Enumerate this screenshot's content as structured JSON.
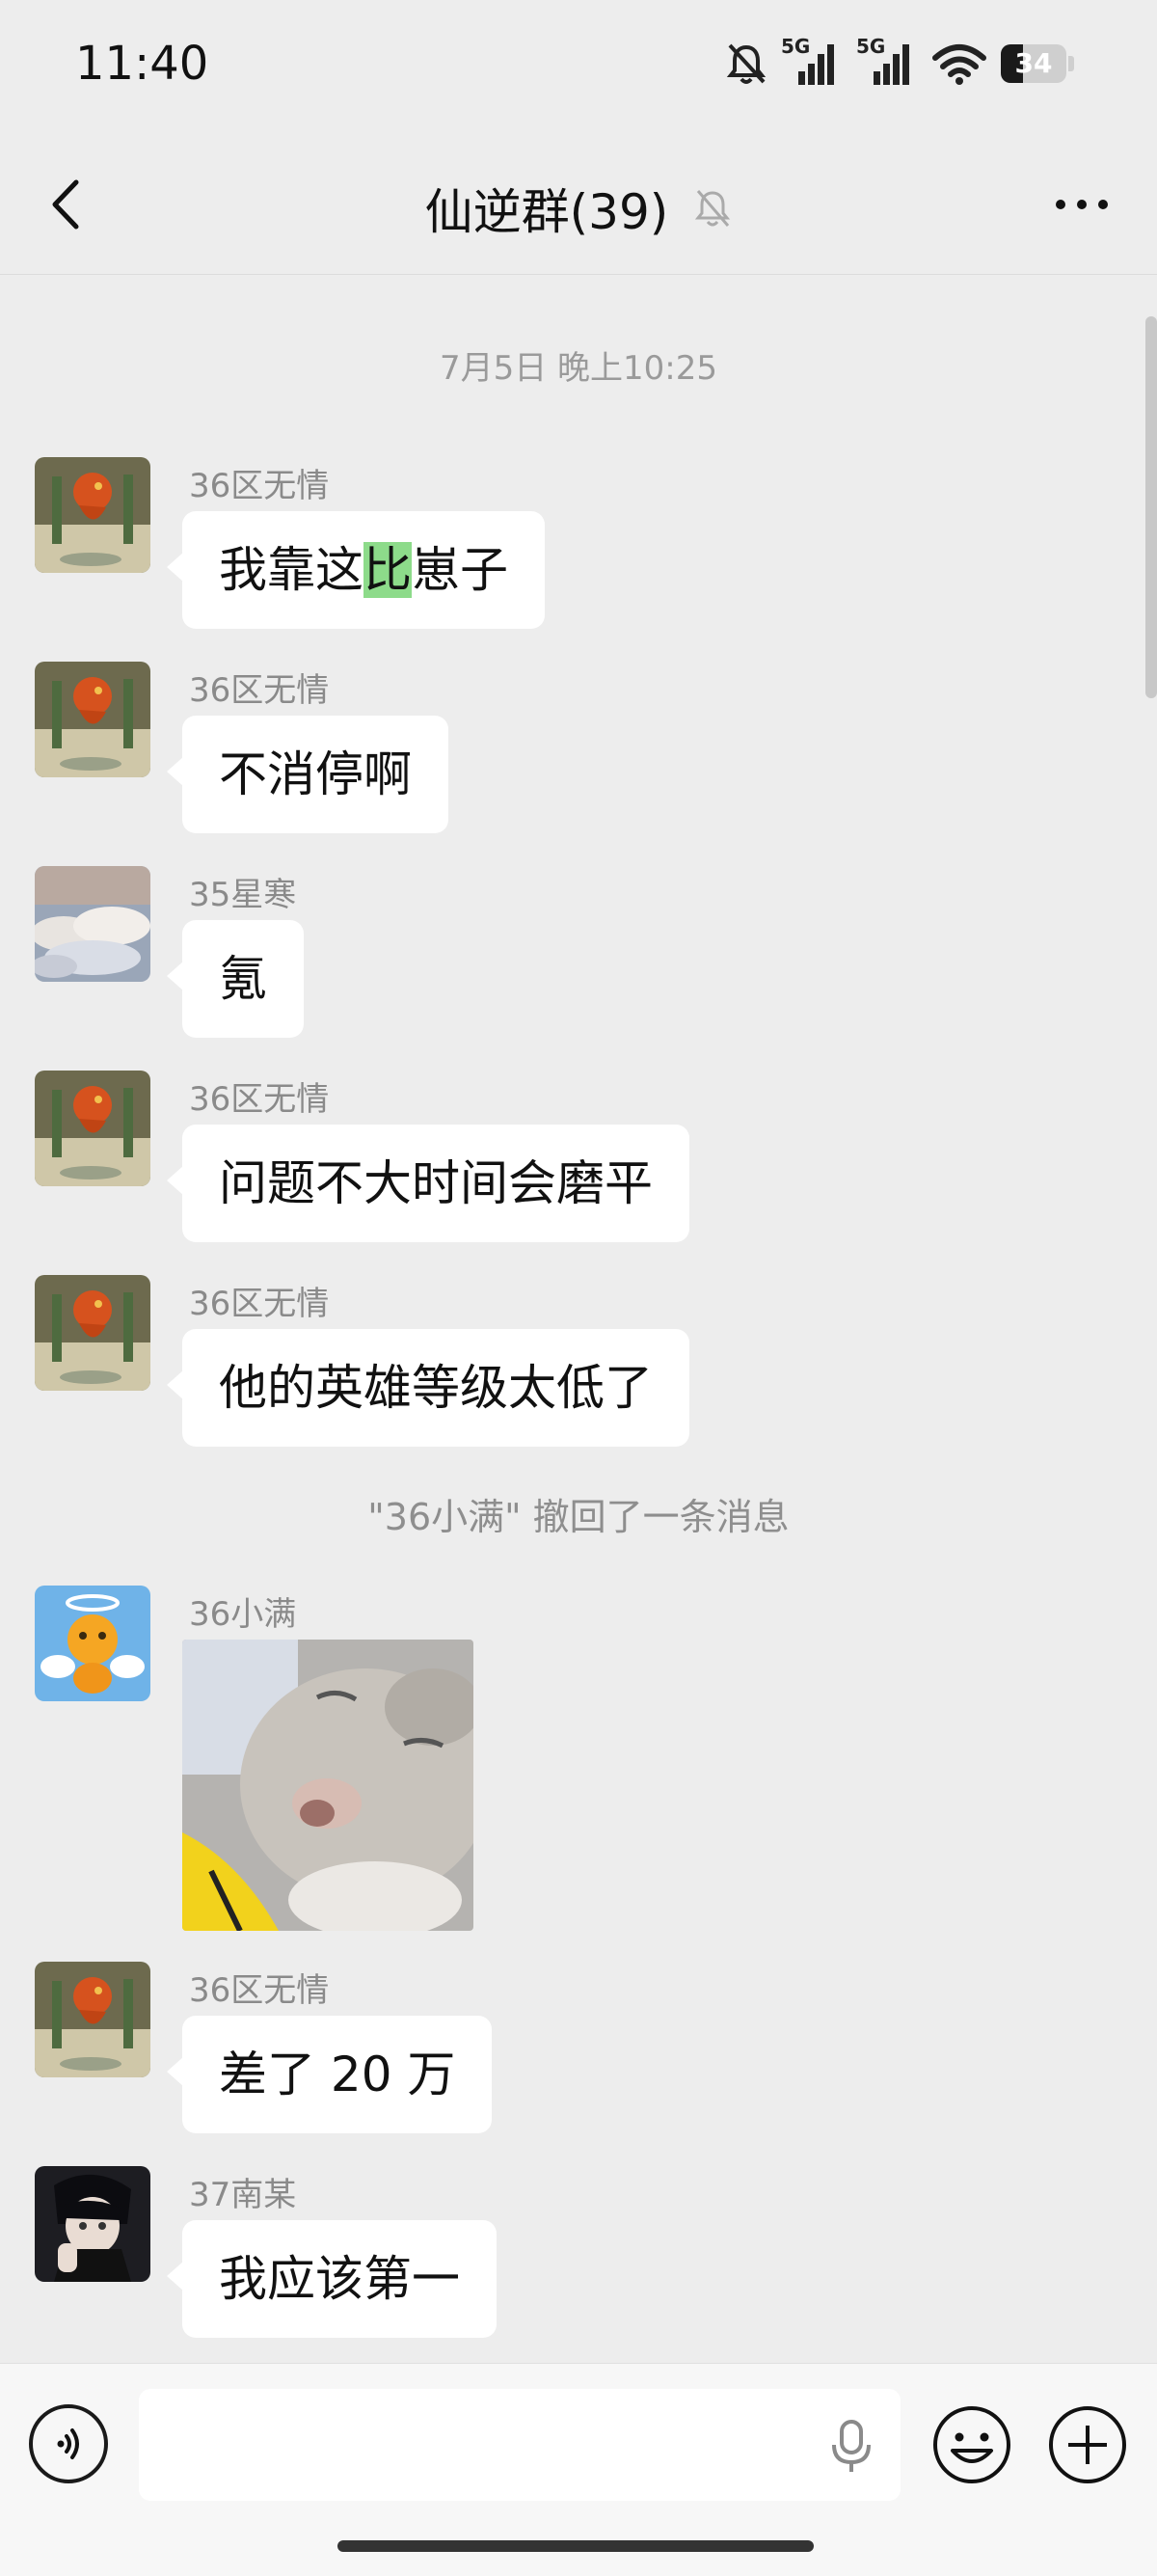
{
  "status_bar": {
    "time": "11:40",
    "signal1_label": "5G",
    "signal2_label": "5G",
    "battery": "34",
    "battery_level": 0.34,
    "icons": [
      "bell-muted-icon",
      "signal-icon",
      "signal-icon",
      "wifi-icon",
      "battery-icon"
    ]
  },
  "header": {
    "title": "仙逆群(39)",
    "back_icon": "chevron-left-icon",
    "muted_icon": "bell-muted-icon",
    "more_icon": "more-horizontal-icon"
  },
  "chat": {
    "timestamp": "7月5日 晚上10:25",
    "messages": [
      {
        "sender": "36区无情",
        "text_before": "我靠这",
        "text_highlight": "比",
        "text_after": "崽子",
        "avatar": "avatar-dragon"
      },
      {
        "sender": "36区无情",
        "text": "不消停啊",
        "avatar": "avatar-dragon"
      },
      {
        "sender": "35星寒",
        "text": "氪",
        "avatar": "avatar-clouds"
      },
      {
        "sender": "36区无情",
        "text": "问题不大时间会磨平",
        "avatar": "avatar-dragon"
      },
      {
        "sender": "36区无情",
        "text": "他的英雄等级太低了",
        "avatar": "avatar-dragon"
      },
      {
        "sender": "36小满",
        "image": "cat-photo",
        "avatar": "avatar-angel-bear"
      },
      {
        "sender": "36区无情",
        "text": "差了 20 万",
        "avatar": "avatar-dragon"
      },
      {
        "sender": "37南某",
        "text": "我应该第一",
        "avatar": "avatar-anime-boy"
      }
    ],
    "system_message": "\"36小满\" 撤回了一条消息",
    "highlight_color": "#8ddb8a"
  },
  "input_bar": {
    "placeholder": "",
    "value": "",
    "icons": [
      "voice-icon",
      "microphone-icon",
      "emoji-icon",
      "plus-icon"
    ]
  }
}
